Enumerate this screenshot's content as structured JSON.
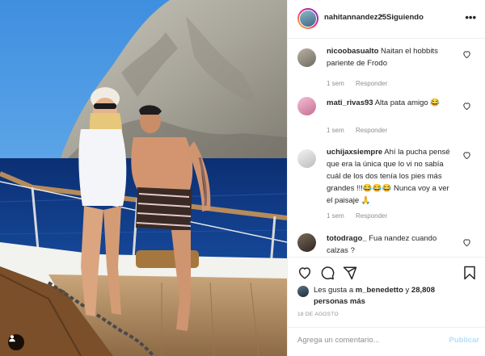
{
  "post": {
    "author": "nahitannandez25",
    "separator": "•",
    "follow_state": "Siguiendo",
    "date": "18 DE AGOSTO"
  },
  "comments": [
    {
      "user": "nicoobasualto",
      "text": "Naitan el hobbits pariente de Frodo",
      "time": "1 sem",
      "reply": "Responder"
    },
    {
      "user": "mati_rivas93",
      "text": "Alta pata amigo 😂",
      "time": "1 sem",
      "reply": "Responder"
    },
    {
      "user": "uchijaxsiempre",
      "text": "Ahí la pucha pensé que era la única que lo vi no sabía cuál de los dos tenía los pies más grandes !!!😂😂😂 Nunca voy a ver el paisaje 🙏",
      "time": "1 sem",
      "reply": "Responder"
    },
    {
      "user": "totodrago_",
      "text": "Fua nandez cuando calzas ?"
    }
  ],
  "likes": {
    "prefix": "Les gusta a",
    "user": "m_benedetto",
    "conj": "y",
    "count": "28,808 personas más"
  },
  "composer": {
    "placeholder": "Agrega un comentario...",
    "publish_label": "Publicar"
  },
  "colors": {
    "link_disabled": "#b2dffc",
    "secondary_text": "#8e8e8e",
    "border": "#efefef"
  }
}
